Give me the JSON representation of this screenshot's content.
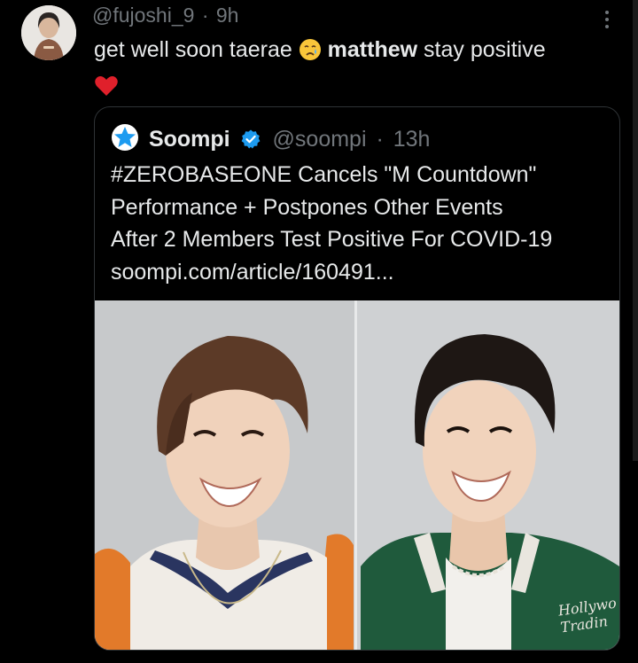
{
  "tweet": {
    "author_handle": "@fujoshi_9",
    "separator": "·",
    "time": "9h",
    "text_part1": "get well soon taerae",
    "text_bold": "matthew",
    "text_part2": "stay positive",
    "emoji_1": "crying-face",
    "emoji_2": "red-heart"
  },
  "quote": {
    "name": "Soompi",
    "handle": "@soompi",
    "separator": "·",
    "time": "13h",
    "lines": [
      "#ZEROBASEONE Cancels \"M Countdown\"",
      "Performance + Postpones Other Events",
      "After 2 Members Test Positive For COVID-19",
      "soompi.com/article/160491..."
    ]
  },
  "image": {
    "overlay_text": "Hollywo Tradin"
  },
  "colors": {
    "background": "#000000",
    "text": "#e7e9ea",
    "secondary": "#71767b",
    "verified": "#1d9bf0",
    "border": "#2f3336"
  }
}
